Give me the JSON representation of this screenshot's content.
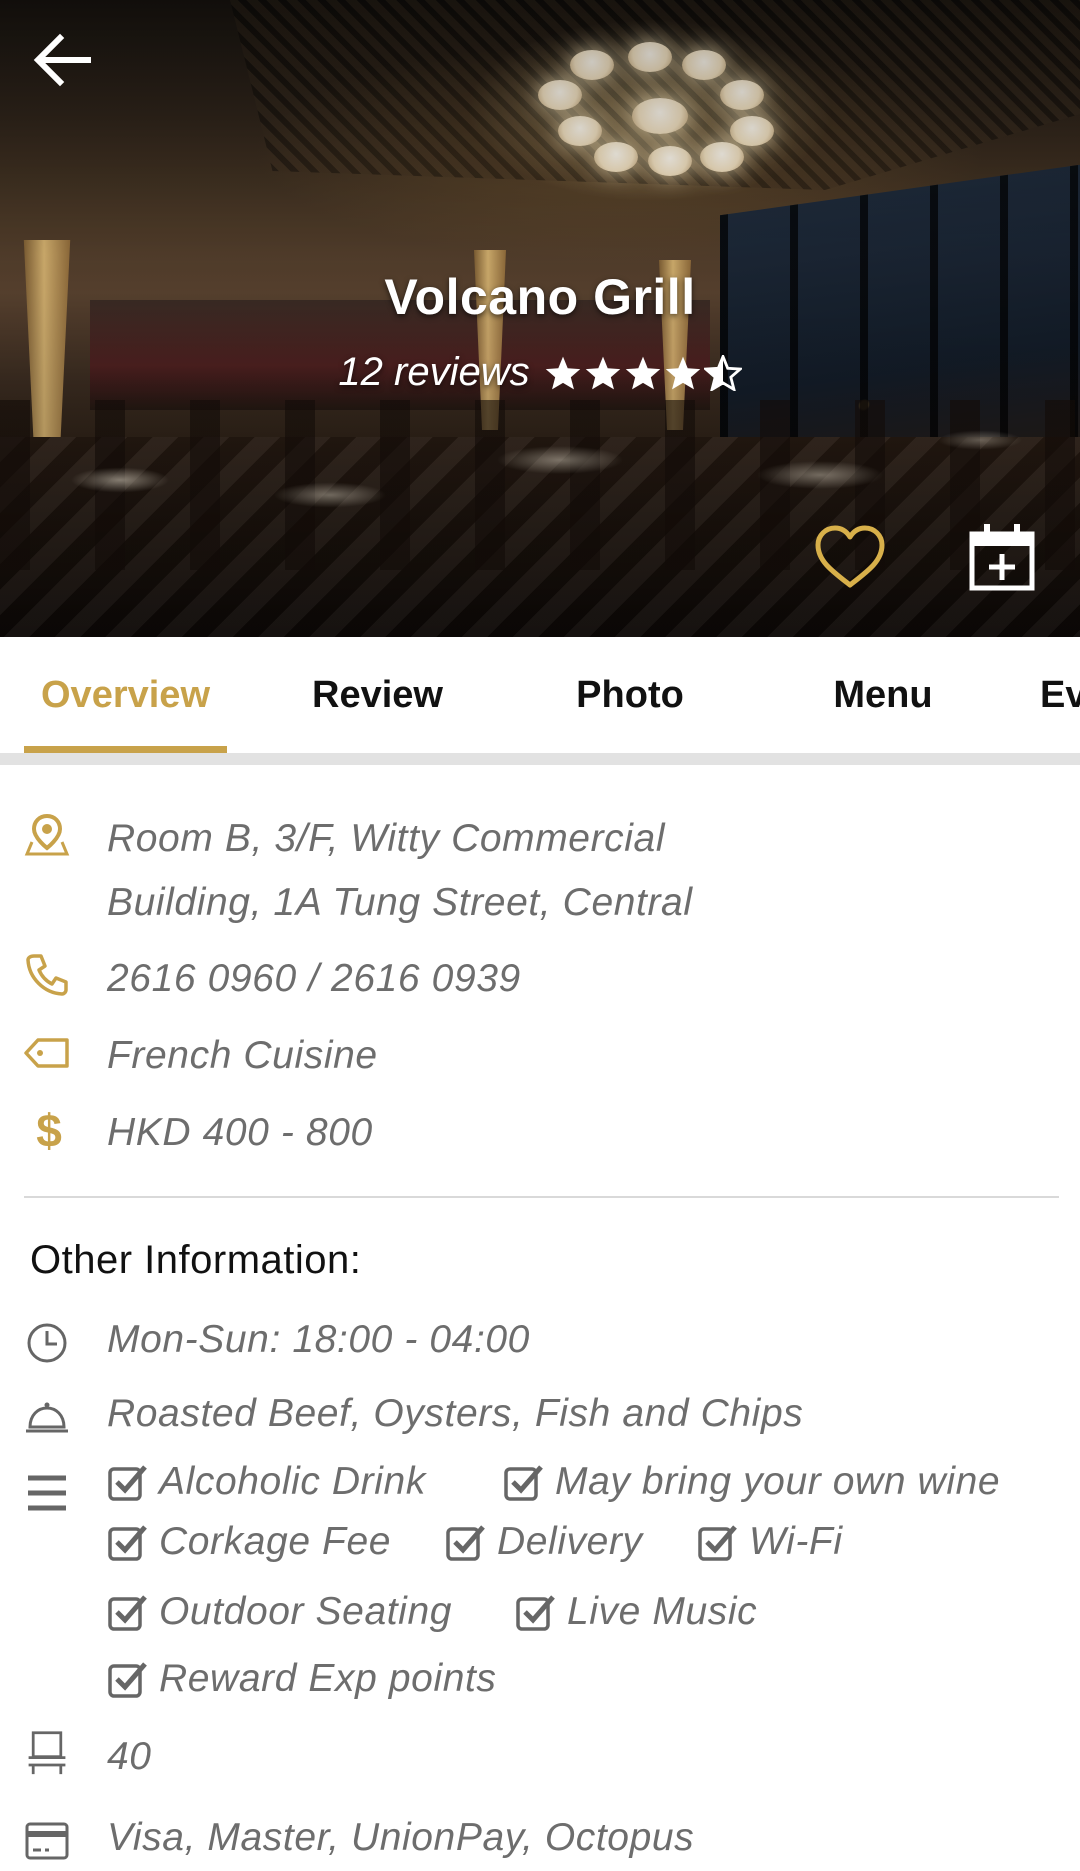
{
  "restaurant": {
    "name": "Volcano Grill",
    "reviews_text": "12 reviews",
    "rating": 4.5
  },
  "hero": {
    "back_icon": "arrow-left-icon",
    "favorite_icon": "heart-outline-icon",
    "calendar_icon": "calendar-plus-icon"
  },
  "tabs": [
    {
      "label": "Overview",
      "active": true
    },
    {
      "label": "Review",
      "active": false
    },
    {
      "label": "Photo",
      "active": false
    },
    {
      "label": "Menu",
      "active": false
    },
    {
      "label": "Ev",
      "active": false
    }
  ],
  "overview": {
    "address_line1": "Room B, 3/F, Witty Commercial",
    "address_line2": "Building, 1A Tung Street, Central",
    "phone": "2616 0960 / 2616 0939",
    "cuisine": "French Cuisine",
    "price": "HKD 400 - 800"
  },
  "other_info": {
    "title": "Other Information:",
    "hours": "Mon-Sun: 18:00 - 04:00",
    "dishes": "Roasted Beef, Oysters, Fish and Chips",
    "features": [
      "Alcoholic Drink",
      "May bring your own wine",
      "Corkage Fee",
      "Delivery",
      "Wi-Fi",
      "Outdoor Seating",
      "Live Music",
      "Reward Exp points"
    ],
    "seats": "40",
    "payment": "Visa, Master, UnionPay, Octopus"
  },
  "colors": {
    "accent": "#c8a24a",
    "text_muted": "#6d6d6d",
    "divider": "#d9d9d9"
  }
}
